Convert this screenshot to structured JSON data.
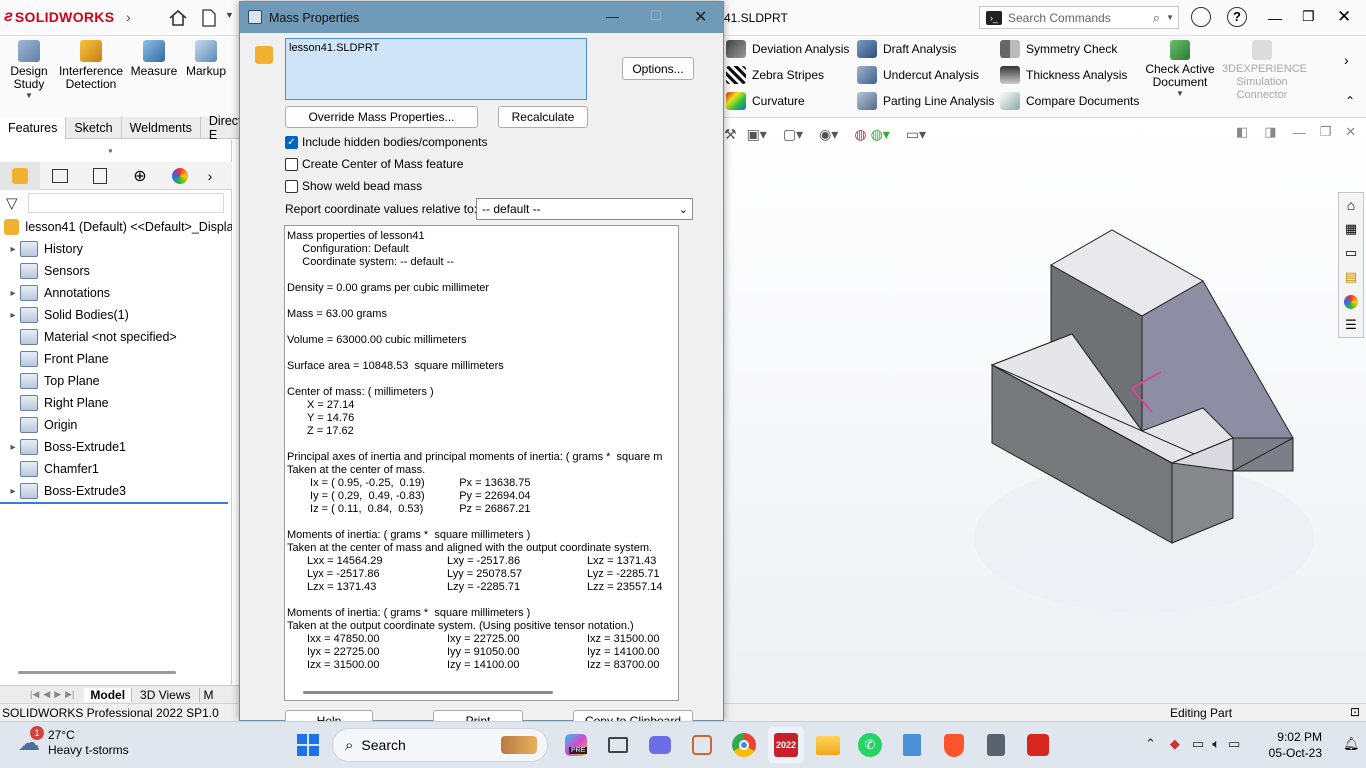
{
  "app": {
    "logo": "SOLIDWORKS",
    "file_title": "41.SLDPRT",
    "search_placeholder": "Search Commands",
    "status_left": "SOLIDWORKS Professional 2022 SP1.0",
    "status_right": "Editing Part"
  },
  "ribbon": {
    "left_tools": [
      {
        "label": "Design Study",
        "icon": "design-study-icon"
      },
      {
        "label": "Interference Detection",
        "icon": "interference-icon"
      },
      {
        "label": "Measure",
        "icon": "measure-icon"
      },
      {
        "label": "Markup",
        "icon": "markup-icon"
      }
    ],
    "evaluate_col1": [
      "Deviation Analysis",
      "Zebra Stripes",
      "Curvature"
    ],
    "evaluate_col2": [
      "Draft Analysis",
      "Undercut Analysis",
      "Parting Line Analysis"
    ],
    "evaluate_col3": [
      "Symmetry Check",
      "Thickness Analysis",
      "Compare Documents"
    ],
    "check_active": "Check Active Document",
    "simulation_connector": "3DEXPERIENCE Simulation Connector"
  },
  "tabs": [
    "Features",
    "Sketch",
    "Weldments",
    "Direct E"
  ],
  "tree": {
    "root": "lesson41 (Default) <<Default>_Display",
    "items": [
      {
        "label": "History",
        "caret": true
      },
      {
        "label": "Sensors",
        "caret": false
      },
      {
        "label": "Annotations",
        "caret": true
      },
      {
        "label": "Solid Bodies(1)",
        "caret": true
      },
      {
        "label": "Material <not specified>",
        "caret": false
      },
      {
        "label": "Front Plane",
        "caret": false
      },
      {
        "label": "Top Plane",
        "caret": false
      },
      {
        "label": "Right Plane",
        "caret": false
      },
      {
        "label": "Origin",
        "caret": false
      },
      {
        "label": "Boss-Extrude1",
        "caret": true
      },
      {
        "label": "Chamfer1",
        "caret": false
      },
      {
        "label": "Boss-Extrude3",
        "caret": true
      }
    ]
  },
  "bottom_tabs": [
    "Model",
    "3D Views",
    "M"
  ],
  "dialog": {
    "title": "Mass Properties",
    "selection": "lesson41.SLDPRT",
    "options_btn": "Options...",
    "override_btn": "Override Mass Properties...",
    "recalc_btn": "Recalculate",
    "chk_hidden": "Include hidden bodies/components",
    "chk_hidden_checked": true,
    "chk_com": "Create Center of Mass feature",
    "chk_weld": "Show weld bead mass",
    "report_label": "Report coordinate values relative to:",
    "report_value": "-- default --",
    "help_btn": "Help",
    "print_btn": "Print",
    "copy_btn": "Copy to Clipboard",
    "results": "Mass properties of lesson41\n     Configuration: Default\n     Coordinate system: -- default --\n\nDensity = 0.00 grams per cubic millimeter\n\nMass = 63.00 grams\n\nVolume = 63000.00 cubic millimeters\n\nSurface area = 10848.53  square millimeters\n\nCenter of mass: ( millimeters )\n\tX = 27.14\n\tY = 14.76\n\tZ = 17.62\n\nPrincipal axes of inertia and principal moments of inertia: ( grams *  square m\nTaken at the center of mass.\n\t Ix = ( 0.95, -0.25,  0.19)   \t    Px = 13638.75\n\t Iy = ( 0.29,  0.49, -0.83)   \t    Py = 22694.04\n\t Iz = ( 0.11,  0.84,  0.53)   \t    Pz = 26867.21\n\nMoments of inertia: ( grams *  square millimeters )\nTaken at the center of mass and aligned with the output coordinate system.\n\tLxx = 14564.29\t\t\t\tLxy = -2517.86\t\t\t\tLxz = 1371.43\n\tLyx = -2517.86\t\t\t\tLyy = 25078.57\t\t\t\tLyz = -2285.71\n\tLzx = 1371.43\t\t\t\tLzy = -2285.71\t\t\t\tLzz = 23557.14\n\nMoments of inertia: ( grams *  square millimeters )\nTaken at the output coordinate system. (Using positive tensor notation.)\n\tIxx = 47850.00\t\t\t\tIxy = 22725.00\t\t\t\tIxz = 31500.00\n\tIyx = 22725.00\t\t\t\tIyy = 91050.00\t\t\t\tIyz = 14100.00\n\tIzx = 31500.00\t\t\t\tIzy = 14100.00\t\t\t\tIzz = 83700.00"
  },
  "taskbar": {
    "weather_temp": "27°C",
    "weather_desc": "Heavy t-storms",
    "weather_badge": "1",
    "search": "Search",
    "time": "9:02 PM",
    "date": "05-Oct-23",
    "sw_badge": "2022",
    "pre_badge": "PRE"
  }
}
